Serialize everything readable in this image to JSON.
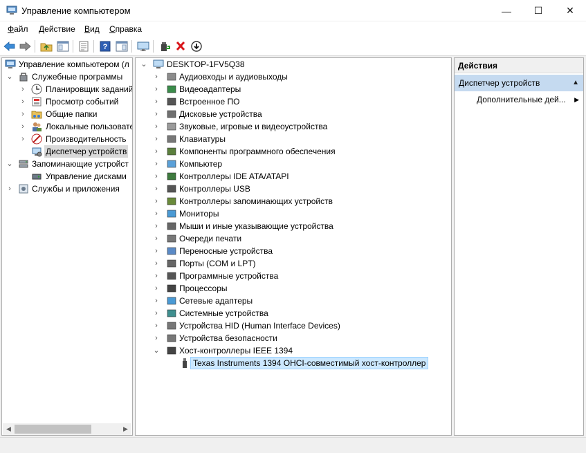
{
  "window": {
    "title": "Управление компьютером",
    "minimize": "—",
    "maximize": "☐",
    "close": "✕"
  },
  "menu": {
    "file_u": "Ф",
    "file_rest": "айл",
    "action_u": "Д",
    "action_rest": "ействие",
    "view_u": "В",
    "view_rest": "ид",
    "help_u": "С",
    "help_rest": "правка"
  },
  "toolbar": {
    "icons": [
      "back-icon",
      "forward-icon",
      "up-folder-icon",
      "show-hide-tree-icon",
      "properties-icon",
      "help-icon",
      "action-pane-icon",
      "monitor-icon",
      "update-driver-icon",
      "uninstall-icon",
      "download-icon"
    ]
  },
  "left_tree": {
    "root": "Управление компьютером (л",
    "system_tools": "Служебные программы",
    "task_scheduler": "Планировщик заданий",
    "event_viewer": "Просмотр событий",
    "shared_folders": "Общие папки",
    "local_users": "Локальные пользовате",
    "performance": "Производительность",
    "device_manager": "Диспетчер устройств",
    "storage": "Запоминающие устройст",
    "disk_management": "Управление дисками",
    "services": "Службы и приложения"
  },
  "device_tree": {
    "computer_name": "DESKTOP-1FV5Q38",
    "categories": [
      "Аудиовходы и аудиовыходы",
      "Видеоадаптеры",
      "Встроенное ПО",
      "Дисковые устройства",
      "Звуковые, игровые и видеоустройства",
      "Клавиатуры",
      "Компоненты программного обеспечения",
      "Компьютер",
      "Контроллеры IDE ATA/ATAPI",
      "Контроллеры USB",
      "Контроллеры запоминающих устройств",
      "Мониторы",
      "Мыши и иные указывающие устройства",
      "Очереди печати",
      "Переносные устройства",
      "Порты (COM и LPT)",
      "Программные устройства",
      "Процессоры",
      "Сетевые адаптеры",
      "Системные устройства",
      "Устройства HID (Human Interface Devices)",
      "Устройства безопасности",
      "Хост-контроллеры IEEE 1394"
    ],
    "selected_device": "Texas Instruments 1394 OHCI-совместимый хост-контроллер"
  },
  "actions": {
    "header": "Действия",
    "section": "Диспетчер устройств",
    "more": "Дополнительные дей..."
  },
  "colors": {
    "selection_blue": "#cce8ff",
    "actions_section": "#c5daf0",
    "accent_blue": "#0078d7"
  }
}
